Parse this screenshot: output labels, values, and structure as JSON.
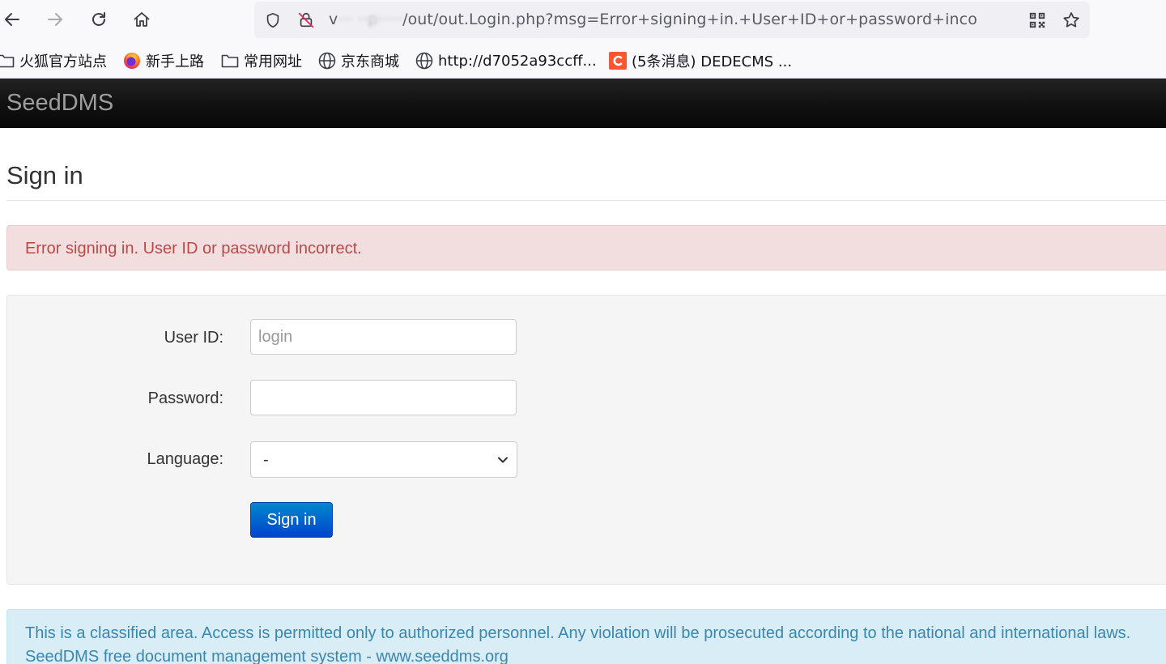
{
  "browser": {
    "url_prefix": "v",
    "url_host": "··· ··p·····",
    "url_path": "/out/out.Login.php?msg=Error+signing+in.+User+ID+or+password+inco",
    "icons": [
      "back-icon",
      "forward-icon",
      "reload-icon",
      "home-icon",
      "shield-icon",
      "insecure-lock-icon",
      "qr-code-icon",
      "star-icon"
    ]
  },
  "bookmarks": [
    {
      "label": "火狐官方站点",
      "icon": "folder-icon"
    },
    {
      "label": "新手上路",
      "icon": "firefox-icon"
    },
    {
      "label": "常用网址",
      "icon": "folder-icon"
    },
    {
      "label": "京东商城",
      "icon": "globe-icon"
    },
    {
      "label": "http://d7052a93ccff...",
      "icon": "globe-icon"
    },
    {
      "label": "(5条消息) DEDECMS ...",
      "icon": "csdn-icon"
    }
  ],
  "app": {
    "brand": "SeedDMS",
    "page_title": "Sign in",
    "error_message": "Error signing in. User ID or password incorrect."
  },
  "form": {
    "userid_label": "User ID:",
    "userid_placeholder": "login",
    "userid_value": "",
    "password_label": "Password:",
    "password_value": "",
    "language_label": "Language:",
    "language_selected": "-",
    "submit_label": "Sign in"
  },
  "notice": {
    "line1": "This is a classified area. Access is permitted only to authorized personnel. Any violation will be prosecuted according to the national and international laws.",
    "line2": "SeedDMS free document management system - www.seeddms.org"
  },
  "colors": {
    "navbar": "#111111",
    "brand_text": "#9d9d9d",
    "error_bg": "#f2dede",
    "error_text": "#b94a48",
    "info_bg": "#d9edf7",
    "info_text": "#3a87ad",
    "button_primary": "#0056d6"
  }
}
